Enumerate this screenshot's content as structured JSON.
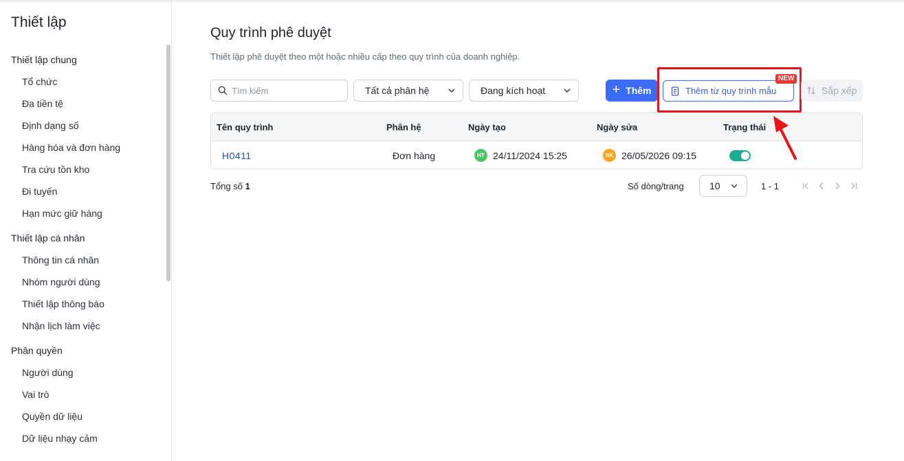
{
  "sidebar": {
    "title": "Thiết lập",
    "groups": [
      {
        "title": "Thiết lập chung",
        "items": [
          "Tổ chức",
          "Đa tiền tệ",
          "Định dạng số",
          "Hàng hóa và đơn hàng",
          "Tra cứu tồn kho",
          "Đi tuyến",
          "Hạn mức giữ hàng"
        ]
      },
      {
        "title": "Thiết lập cá nhân",
        "items": [
          "Thông tin cá nhân",
          "Nhóm người dùng",
          "Thiết lập thông báo",
          "Nhận lịch làm việc"
        ]
      },
      {
        "title": "Phân quyền",
        "items": [
          "Người dùng",
          "Vai trò",
          "Quyền dữ liệu",
          "Dữ liệu nhạy cảm"
        ]
      }
    ]
  },
  "main": {
    "title": "Quy trình phê duyệt",
    "description": "Thiết lập phê duyệt theo một hoặc nhiều cấp theo quy trình của doanh nghiệp.",
    "search": {
      "placeholder": "Tìm kiếm",
      "icon": "search-icon"
    },
    "filter_module": {
      "value": "Tất cả phân hệ"
    },
    "filter_status": {
      "value": "Đang kích hoạt"
    },
    "add_button": {
      "label": "Thêm",
      "icon": "plus-icon"
    },
    "template_button": {
      "label": "Thêm từ quy trình mẫu",
      "badge": "NEW",
      "icon": "document-icon"
    },
    "sort_button": {
      "label": "Sắp xếp",
      "icon": "sort-icon"
    }
  },
  "table": {
    "columns": [
      "Tên quy trình",
      "Phân hệ",
      "Ngày tạo",
      "Ngày sửa",
      "Trạng thái"
    ],
    "rows": [
      {
        "name": "H0411",
        "module": "Đơn hàng",
        "created_by": "HT",
        "created_color": "#4cc46a",
        "created_at": "24/11/2024 15:25",
        "modified_by": "NK",
        "modified_color": "#f5a623",
        "modified_at": "26/05/2026 09:15",
        "active": true
      }
    ]
  },
  "footer": {
    "total_label": "Tổng số",
    "total_value": "1",
    "rows_per_page_label": "Số dòng/trang",
    "rows_per_page": "10",
    "range": "1 - 1"
  },
  "colors": {
    "primary": "#3b6cf6",
    "highlight": "#e8141d",
    "toggle_on": "#1bae8e",
    "badge": "#e53935"
  }
}
